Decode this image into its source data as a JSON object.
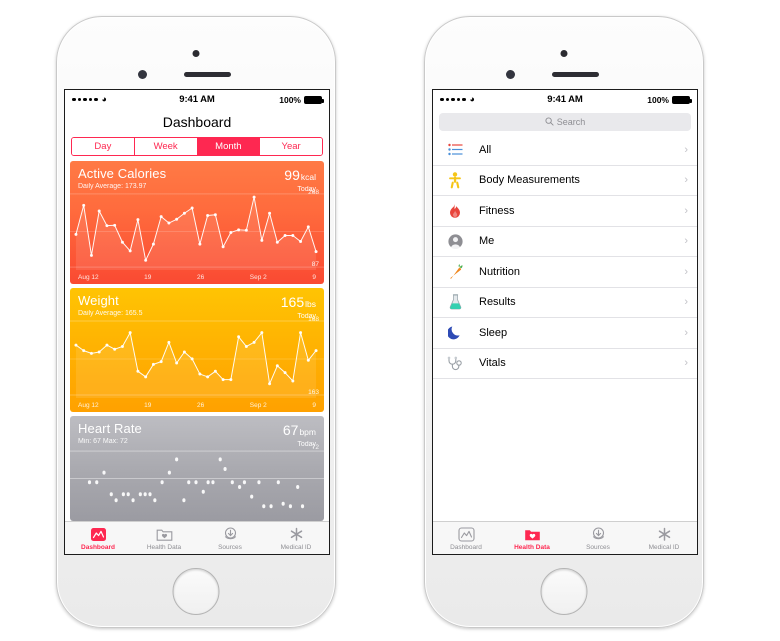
{
  "status_bar": {
    "carrier_dots": 5,
    "wifi_icon": "wifi-icon",
    "time": "9:41 AM",
    "battery_percent": "100%"
  },
  "dashboard_phone": {
    "nav_title": "Dashboard",
    "segmented_control": {
      "options": [
        "Day",
        "Week",
        "Month",
        "Year"
      ],
      "selected": "Month"
    },
    "cards": [
      {
        "id": "active-calories",
        "title": "Active Calories",
        "subtitle": "Daily Average: 173.97",
        "value": "99",
        "unit": "kcal",
        "period": "Today",
        "y_max": "268",
        "y_min": "87",
        "x_labels": [
          "Aug 12",
          "19",
          "26",
          "Sep 2",
          "9"
        ],
        "accent": "#fa4a32"
      },
      {
        "id": "weight",
        "title": "Weight",
        "subtitle": "Daily Average: 165.5",
        "value": "165",
        "unit": "lbs",
        "period": "Today",
        "y_max": "168",
        "y_min": "163",
        "x_labels": [
          "Aug 12",
          "19",
          "26",
          "Sep 2",
          "9"
        ],
        "accent": "#ffb302"
      },
      {
        "id": "heart-rate",
        "title": "Heart Rate",
        "subtitle": "Min: 67  Max: 72",
        "value": "67",
        "unit": "bpm",
        "period": "Today",
        "y_max": "72",
        "accent": "#a8a8ae"
      }
    ],
    "tabs": [
      {
        "label": "Dashboard",
        "icon": "dashboard-chart-icon",
        "active": true
      },
      {
        "label": "Health Data",
        "icon": "health-data-folder-icon",
        "active": false
      },
      {
        "label": "Sources",
        "icon": "sources-download-icon",
        "active": false
      },
      {
        "label": "Medical ID",
        "icon": "medical-id-asterisk-icon",
        "active": false
      }
    ]
  },
  "health_data_phone": {
    "search": {
      "placeholder": "Search",
      "icon": "search-icon"
    },
    "list_items": [
      {
        "label": "All",
        "icon": "list-lines-icon",
        "chevron": "›"
      },
      {
        "label": "Body Measurements",
        "icon": "body-figure-icon",
        "chevron": "›"
      },
      {
        "label": "Fitness",
        "icon": "flame-icon",
        "chevron": "›"
      },
      {
        "label": "Me",
        "icon": "person-circle-icon",
        "chevron": "›"
      },
      {
        "label": "Nutrition",
        "icon": "carrot-icon",
        "chevron": "›"
      },
      {
        "label": "Results",
        "icon": "flask-icon",
        "chevron": "›"
      },
      {
        "label": "Sleep",
        "icon": "moon-icon",
        "chevron": "›"
      },
      {
        "label": "Vitals",
        "icon": "stethoscope-icon",
        "chevron": "›"
      }
    ],
    "tabs": [
      {
        "label": "Dashboard",
        "icon": "dashboard-chart-icon",
        "active": false
      },
      {
        "label": "Health Data",
        "icon": "health-data-folder-icon",
        "active": true
      },
      {
        "label": "Sources",
        "icon": "sources-download-icon",
        "active": false
      },
      {
        "label": "Medical ID",
        "icon": "medical-id-asterisk-icon",
        "active": false
      }
    ]
  },
  "chart_data": [
    {
      "type": "line",
      "title": "Active Calories",
      "ylabel": "kcal",
      "ylim": [
        87,
        268
      ],
      "x_tick_labels": [
        "Aug 12",
        "19",
        "26",
        "Sep 2",
        "9"
      ],
      "values": [
        166,
        243,
        110,
        228,
        189,
        190,
        145,
        122,
        205,
        97,
        140,
        213,
        196,
        206,
        222,
        236,
        140,
        216,
        218,
        133,
        171,
        178,
        177,
        265,
        150,
        222,
        145,
        163,
        163,
        147,
        186,
        120
      ]
    },
    {
      "type": "line",
      "title": "Weight",
      "ylabel": "lbs",
      "ylim": [
        163,
        168
      ],
      "x_tick_labels": [
        "Aug 12",
        "19",
        "26",
        "Sep 2",
        "9"
      ],
      "values": [
        166.4,
        166.0,
        165.8,
        165.9,
        166.4,
        166.1,
        166.3,
        167.3,
        164.5,
        164.1,
        165.0,
        165.2,
        166.6,
        165.1,
        165.9,
        165.4,
        164.3,
        164.1,
        164.5,
        163.9,
        163.9,
        167.0,
        166.3,
        166.6,
        167.3,
        163.6,
        164.9,
        164.4,
        163.8,
        167.3,
        165.3,
        166.0
      ]
    },
    {
      "type": "scatter",
      "title": "Heart Rate",
      "ylabel": "bpm",
      "ylim": [
        67,
        72
      ],
      "points": [
        [
          0.06,
          69.4
        ],
        [
          0.09,
          69.4
        ],
        [
          0.12,
          70.2
        ],
        [
          0.15,
          68.4
        ],
        [
          0.17,
          67.9
        ],
        [
          0.2,
          68.4
        ],
        [
          0.22,
          68.4
        ],
        [
          0.24,
          67.9
        ],
        [
          0.27,
          68.4
        ],
        [
          0.29,
          68.4
        ],
        [
          0.31,
          68.4
        ],
        [
          0.33,
          67.9
        ],
        [
          0.36,
          69.4
        ],
        [
          0.39,
          70.2
        ],
        [
          0.42,
          71.3
        ],
        [
          0.45,
          67.9
        ],
        [
          0.47,
          69.4
        ],
        [
          0.5,
          69.4
        ],
        [
          0.53,
          68.6
        ],
        [
          0.55,
          69.4
        ],
        [
          0.57,
          69.4
        ],
        [
          0.6,
          71.3
        ],
        [
          0.62,
          70.5
        ],
        [
          0.65,
          69.4
        ],
        [
          0.68,
          69.0
        ],
        [
          0.7,
          69.4
        ],
        [
          0.73,
          68.2
        ],
        [
          0.76,
          69.4
        ],
        [
          0.78,
          67.4
        ],
        [
          0.81,
          67.4
        ],
        [
          0.84,
          69.4
        ],
        [
          0.86,
          67.6
        ],
        [
          0.89,
          67.4
        ],
        [
          0.92,
          69.0
        ],
        [
          0.94,
          67.4
        ]
      ]
    }
  ]
}
